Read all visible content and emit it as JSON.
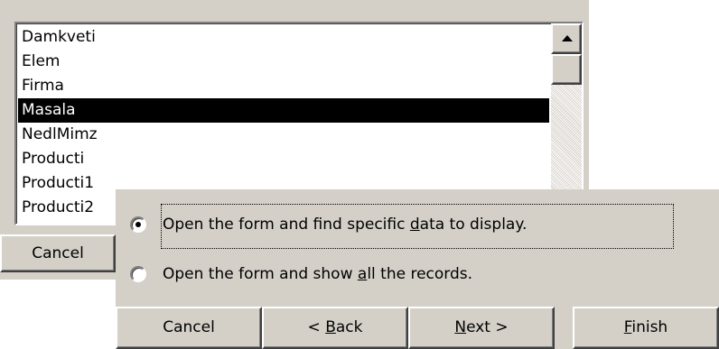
{
  "table_list": {
    "items": [
      "Damkveti",
      "Elem",
      "Firma",
      "Masala",
      "NedlMimz",
      "Producti",
      "Producti1",
      "Producti2"
    ],
    "selected_index": 3
  },
  "back_dialog": {
    "cancel_label": "Cancel"
  },
  "options": {
    "find_specific": {
      "text_before": "Open the form and find specific ",
      "accel": "d",
      "text_after": "ata to display.",
      "checked": true
    },
    "show_all": {
      "text_before": "Open the form and show ",
      "accel": "a",
      "text_after": "ll the records.",
      "checked": false
    }
  },
  "buttons": {
    "cancel": {
      "label": "Cancel"
    },
    "back": {
      "prefix": "< ",
      "accel": "B",
      "rest": "ack"
    },
    "next": {
      "accel": "N",
      "rest": "ext >"
    },
    "finish": {
      "accel": "F",
      "rest": "inish"
    }
  },
  "icons": {
    "scroll_up": "arrow-up-icon"
  },
  "colors": {
    "dialog_face": "#d4d0c8",
    "selection_bg": "#000000",
    "selection_fg": "#ffffff"
  }
}
